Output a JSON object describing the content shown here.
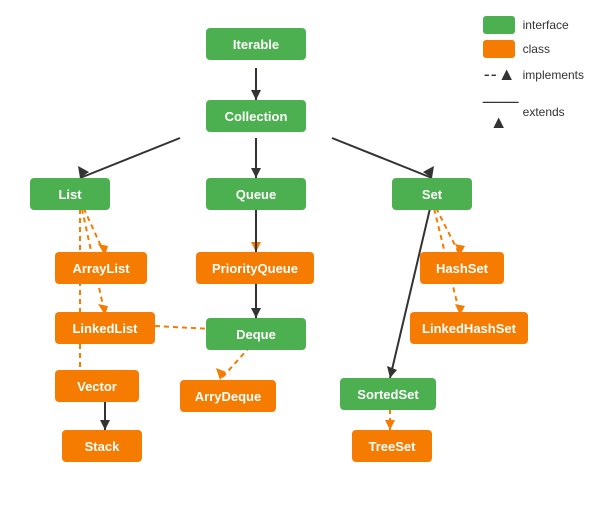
{
  "legend": {
    "interface_label": "interface",
    "class_label": "class",
    "implements_label": "implements",
    "extends_label": "extends",
    "interface_color": "#4caf50",
    "class_color": "#f57c00"
  },
  "nodes": {
    "iterable": {
      "label": "Iterable",
      "type": "interface"
    },
    "collection": {
      "label": "Collection",
      "type": "interface"
    },
    "list": {
      "label": "List",
      "type": "interface"
    },
    "queue": {
      "label": "Queue",
      "type": "interface"
    },
    "set": {
      "label": "Set",
      "type": "interface"
    },
    "priorityqueue": {
      "label": "PriorityQueue",
      "type": "class"
    },
    "deque": {
      "label": "Deque",
      "type": "interface"
    },
    "sortedset": {
      "label": "SortedSet",
      "type": "interface"
    },
    "hashset": {
      "label": "HashSet",
      "type": "class"
    },
    "linkedhashset": {
      "label": "LinkedHashSet",
      "type": "class"
    },
    "arraylist": {
      "label": "ArrayList",
      "type": "class"
    },
    "linkedlist": {
      "label": "LinkedList",
      "type": "class"
    },
    "vector": {
      "label": "Vector",
      "type": "class"
    },
    "stack": {
      "label": "Stack",
      "type": "class"
    },
    "arrydeque": {
      "label": "ArryDeque",
      "type": "class"
    },
    "treeset": {
      "label": "TreeSet",
      "type": "class"
    }
  }
}
